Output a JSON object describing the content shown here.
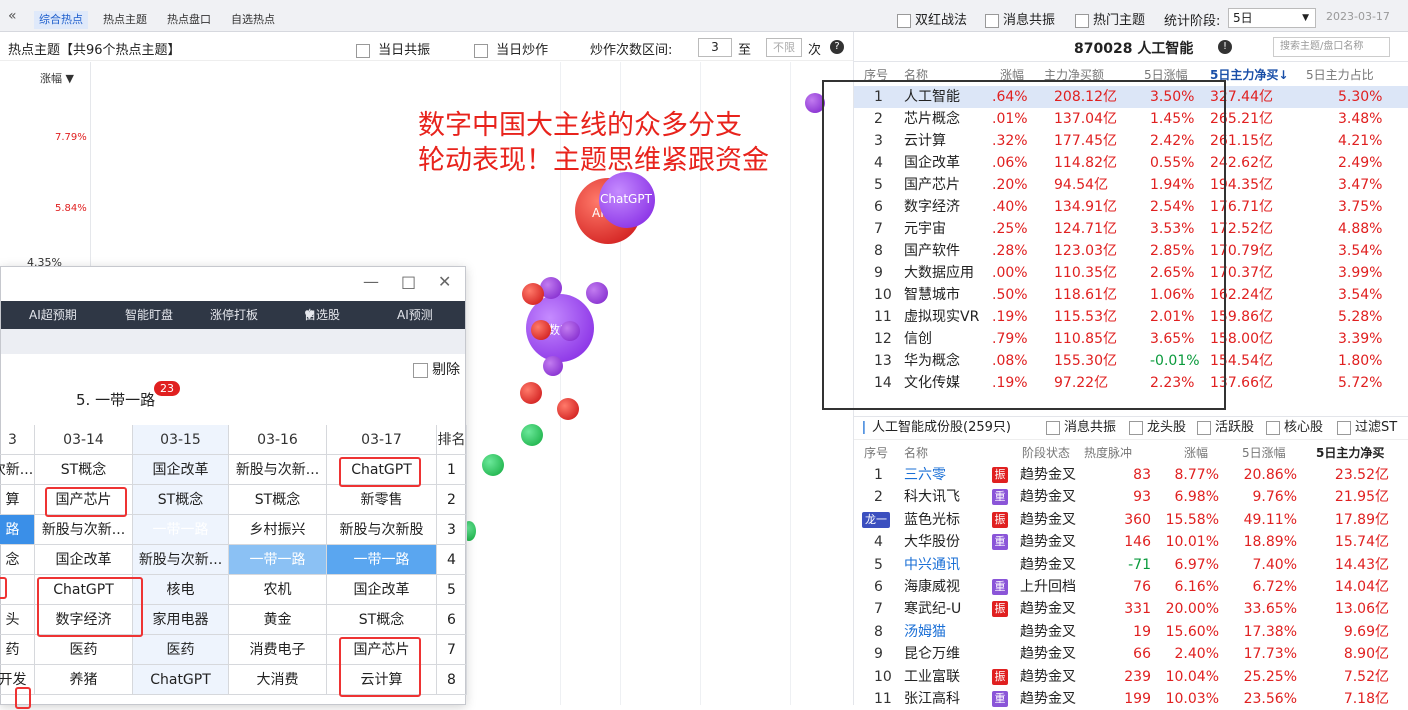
{
  "topbar": {
    "back": "«",
    "tabs": [
      "综合热点",
      "热点主题",
      "热点盘口",
      "自选热点"
    ],
    "filters": [
      "双红战法",
      "消息共振",
      "热门主题"
    ],
    "stage_label": "统计阶段:",
    "stage_value": "5日",
    "date": "2023-03-17"
  },
  "header": {
    "title": "热点主题【共96个热点主题】",
    "opt1": "当日共振",
    "opt2": "当日炒作",
    "range_label": "炒作次数区间:",
    "range_min": "3",
    "range_to": "至",
    "range_max": "不限",
    "range_unit": "次"
  },
  "chart": {
    "col_label": "涨幅 ▼",
    "ticks": [
      "7.79%",
      "5.84%",
      "4.35%"
    ],
    "bubble_labels": [
      "ChatGPT",
      "AI",
      "数字"
    ]
  },
  "annotation": [
    "数字中国大主线的众多分支",
    "轮动表现！主题思维紧跟资金"
  ],
  "right": {
    "title": "870028 人工智能",
    "search_placeholder": "搜索主题/盘口名称",
    "cols": [
      "序号",
      "名称",
      "涨幅",
      "主力净买额",
      "5日涨幅",
      "5日主力净买↓",
      "5日主力占比"
    ],
    "rows": [
      {
        "n": "1",
        "name": "人工智能",
        "chg": ".64%",
        "buy": "208.12亿",
        "chg5": "3.50%",
        "buy5": "327.44亿",
        "ratio": "5.30%"
      },
      {
        "n": "2",
        "name": "芯片概念",
        "chg": ".01%",
        "buy": "137.04亿",
        "chg5": "1.45%",
        "buy5": "265.21亿",
        "ratio": "3.48%"
      },
      {
        "n": "3",
        "name": "云计算",
        "chg": ".32%",
        "buy": "177.45亿",
        "chg5": "2.42%",
        "buy5": "261.15亿",
        "ratio": "4.21%"
      },
      {
        "n": "4",
        "name": "国企改革",
        "chg": ".06%",
        "buy": "114.82亿",
        "chg5": "0.55%",
        "buy5": "242.62亿",
        "ratio": "2.49%"
      },
      {
        "n": "5",
        "name": "国产芯片",
        "chg": ".20%",
        "buy": "94.54亿",
        "chg5": "1.94%",
        "buy5": "194.35亿",
        "ratio": "3.47%"
      },
      {
        "n": "6",
        "name": "数字经济",
        "chg": ".40%",
        "buy": "134.91亿",
        "chg5": "2.54%",
        "buy5": "176.71亿",
        "ratio": "3.75%"
      },
      {
        "n": "7",
        "name": "元宇宙",
        "chg": ".25%",
        "buy": "124.71亿",
        "chg5": "3.53%",
        "buy5": "172.52亿",
        "ratio": "4.88%"
      },
      {
        "n": "8",
        "name": "国产软件",
        "chg": ".28%",
        "buy": "123.03亿",
        "chg5": "2.85%",
        "buy5": "170.79亿",
        "ratio": "3.54%"
      },
      {
        "n": "9",
        "name": "大数据应用",
        "chg": ".00%",
        "buy": "110.35亿",
        "chg5": "2.65%",
        "buy5": "170.37亿",
        "ratio": "3.99%"
      },
      {
        "n": "10",
        "name": "智慧城市",
        "chg": ".50%",
        "buy": "118.61亿",
        "chg5": "1.06%",
        "buy5": "162.24亿",
        "ratio": "3.54%"
      },
      {
        "n": "11",
        "name": "虚拟现实VR",
        "chg": ".19%",
        "buy": "115.53亿",
        "chg5": "2.01%",
        "buy5": "159.86亿",
        "ratio": "5.28%"
      },
      {
        "n": "12",
        "name": "信创",
        "chg": ".79%",
        "buy": "110.85亿",
        "chg5": "3.65%",
        "buy5": "158.00亿",
        "ratio": "3.39%"
      },
      {
        "n": "13",
        "name": "华为概念",
        "chg": ".08%",
        "buy": "155.30亿",
        "chg5": "-0.01%",
        "buy5": "154.54亿",
        "ratio": "1.80%"
      },
      {
        "n": "14",
        "name": "文化传媒",
        "chg": ".19%",
        "buy": "97.22亿",
        "chg5": "2.23%",
        "buy5": "137.66亿",
        "ratio": "5.72%"
      }
    ],
    "stocks_title": "人工智能成份股(259只)",
    "stock_filters": [
      "消息共振",
      "龙头股",
      "活跃股",
      "核心股",
      "过滤ST"
    ],
    "stock_cols": [
      "序号",
      "名称",
      "阶段状态",
      "热度脉冲",
      "涨幅",
      "5日涨幅",
      "5日主力净买"
    ],
    "stocks": [
      {
        "n": "1",
        "name": "三六零",
        "tag": "振",
        "state": "趋势金叉",
        "heat": "83",
        "chg": "8.77%",
        "chg5": "20.86%",
        "buy5": "23.52亿"
      },
      {
        "n": "2",
        "name": "科大讯飞",
        "tag": "重",
        "state": "趋势金叉",
        "heat": "93",
        "chg": "6.98%",
        "chg5": "9.76%",
        "buy5": "21.95亿"
      },
      {
        "n": "龙一",
        "name": "蓝色光标",
        "tag": "振",
        "state": "趋势金叉",
        "heat": "360",
        "chg": "15.58%",
        "chg5": "49.11%",
        "buy5": "17.89亿"
      },
      {
        "n": "4",
        "name": "大华股份",
        "tag": "重",
        "state": "趋势金叉",
        "heat": "146",
        "chg": "10.01%",
        "chg5": "18.89%",
        "buy5": "15.74亿"
      },
      {
        "n": "5",
        "name": "中兴通讯",
        "tag": "",
        "state": "趋势金叉",
        "heat": "-71",
        "chg": "6.97%",
        "chg5": "7.40%",
        "buy5": "14.43亿"
      },
      {
        "n": "6",
        "name": "海康威视",
        "tag": "重",
        "state": "上升回档",
        "heat": "76",
        "chg": "6.16%",
        "chg5": "6.72%",
        "buy5": "14.04亿"
      },
      {
        "n": "7",
        "name": "寒武纪-U",
        "tag": "振",
        "state": "趋势金叉",
        "heat": "331",
        "chg": "20.00%",
        "chg5": "33.65%",
        "buy5": "13.06亿"
      },
      {
        "n": "8",
        "name": "汤姆猫",
        "tag": "",
        "state": "趋势金叉",
        "heat": "19",
        "chg": "15.60%",
        "chg5": "17.38%",
        "buy5": "9.69亿"
      },
      {
        "n": "9",
        "name": "昆仑万维",
        "tag": "",
        "state": "趋势金叉",
        "heat": "66",
        "chg": "2.40%",
        "chg5": "17.73%",
        "buy5": "8.90亿"
      },
      {
        "n": "10",
        "name": "工业富联",
        "tag": "振",
        "state": "趋势金叉",
        "heat": "239",
        "chg": "10.04%",
        "chg5": "25.25%",
        "buy5": "7.52亿"
      },
      {
        "n": "11",
        "name": "张江高科",
        "tag": "重",
        "state": "趋势金叉",
        "heat": "199",
        "chg": "10.03%",
        "chg5": "23.56%",
        "buy5": "7.18亿"
      }
    ]
  },
  "window": {
    "minimize": "—",
    "maximize": "□",
    "close": "✕",
    "nav": [
      "AI超预期",
      "智能盯盘",
      "涨停打板",
      "自选股",
      "AI预测"
    ],
    "exclude": "剔除",
    "rank_title": "5. 一带一路",
    "badge": "23",
    "dates": [
      "3",
      "03-14",
      "03-15",
      "03-16",
      "03-17"
    ],
    "rank_col": "排名",
    "grid": [
      [
        "次新...",
        "ST概念",
        "国企改革",
        "新股与次新...",
        "ChatGPT",
        "1"
      ],
      [
        "算",
        "国产芯片",
        "ST概念",
        "ST概念",
        "新零售",
        "2"
      ],
      [
        "路",
        "新股与次新...",
        "一带一路",
        "乡村振兴",
        "新股与次新股",
        "3"
      ],
      [
        "念",
        "国企改革",
        "新股与次新...",
        "一带一路",
        "一带一路",
        "4"
      ],
      [
        "",
        "ChatGPT",
        "核电",
        "农机",
        "国企改革",
        "5"
      ],
      [
        "头",
        "数字经济",
        "家用电器",
        "黄金",
        "ST概念",
        "6"
      ],
      [
        "药",
        "医药",
        "医药",
        "消费电子",
        "国产芯片",
        "7"
      ],
      [
        "开发",
        "养猪",
        "ChatGPT",
        "大消费",
        "云计算",
        "8"
      ]
    ]
  }
}
